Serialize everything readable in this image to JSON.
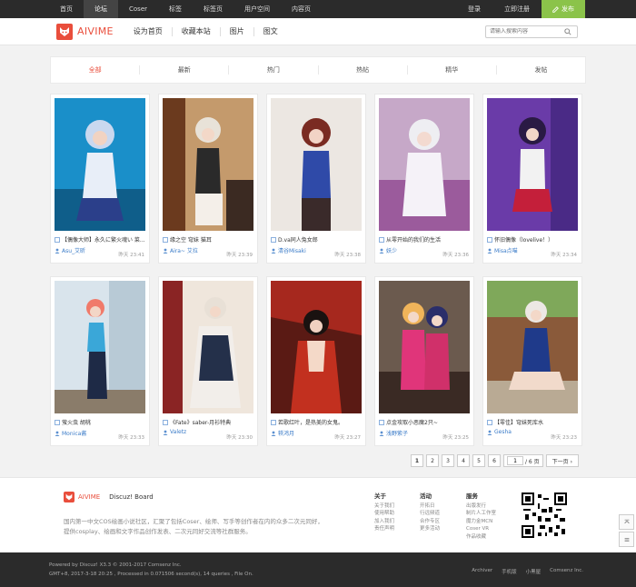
{
  "topnav": [
    "首页",
    "论坛",
    "Coser",
    "标签",
    "标签页",
    "用户空间",
    "内容页"
  ],
  "topright": {
    "login": "登录",
    "register": "立即注册",
    "publish": "发布"
  },
  "logo": {
    "text": "AIVIME"
  },
  "mainnav": [
    "设为首页",
    "收藏本站",
    "图片",
    "图文"
  ],
  "search": {
    "placeholder": "请输入搜索内容"
  },
  "tabs": [
    "全部",
    "最新",
    "热门",
    "热帖",
    "精华",
    "发帖"
  ],
  "cards": [
    {
      "title": "【偶像大师】永久に繁火魂い  菜...",
      "author": "Asu_艾昕",
      "time": "昨天 23:41"
    },
    {
      "title": "缘之空 穹妹 猫耳",
      "author": "Aira~ 艾拉",
      "time": "昨天 23:39"
    },
    {
      "title": "D.va同人兔女郎",
      "author": "清谷Misaki",
      "time": "昨天 23:38"
    },
    {
      "title": "从零开始的我们的生活",
      "author": "妖少",
      "time": "昨天 23:36"
    },
    {
      "title": "怀旧偶像（lovelive！）",
      "author": "Misa点喵",
      "time": "昨天 23:34"
    },
    {
      "title": "萤火虫 胡桃",
      "author": "Monica酱",
      "time": "昨天 23:33"
    },
    {
      "title": "《Fate》saber-月衫特典",
      "author": "Valetz",
      "time": "昨天 23:30"
    },
    {
      "title": "若歌红叶，是热美的女鬼。",
      "author": "轶鸿月",
      "time": "昨天 23:27"
    },
    {
      "title": "点金攻取小恶魔2只~",
      "author": "浅野紫子",
      "time": "昨天 23:25"
    },
    {
      "title": "【零佳】穹妹死库水",
      "author": "Gesha",
      "time": "昨天 23:23"
    }
  ],
  "pager": {
    "pages": [
      "1",
      "2",
      "3",
      "4",
      "5",
      "6"
    ],
    "current": "1",
    "input": "1",
    "total": "/ 6 页",
    "next": "下一页 ›"
  },
  "footer": {
    "logo": "AIVIME",
    "board": "Discuz! Board",
    "desc": "国内第一中文COS绘画小说社区，汇聚了包括Coser、绘师、写手等创作者在内的众多二次元同好，提供cosplay、绘画和文字作品创作发表、二次元同好交流等社群服务。",
    "cols": [
      {
        "title": "关于",
        "items": [
          "关于我们",
          "使用帮助",
          "加入我们",
          "责任声明"
        ]
      },
      {
        "title": "活动",
        "items": [
          "开拓日",
          "行远频道",
          "合作专区",
          "更多活动"
        ]
      },
      {
        "title": "服务",
        "items": [
          "出版发行",
          "制片人工作室",
          "魔力金MCN",
          "Coser VR",
          "作品收藏"
        ]
      }
    ]
  },
  "bottom": {
    "line1": "Powered by Discuz! X3.3 © 2001-2017 Comsenz Inc.",
    "line2": "GMT+8, 2017-3-18 20:25 , Processed in 0.071506 second(s), 14 queries , File On.",
    "links": [
      "Archiver",
      "手机版",
      "小黑屋",
      "Comsenz Inc."
    ]
  },
  "colors": {
    "brand": "#e94e3c",
    "publish": "#8bc34a",
    "topbar": "#2b2b2b",
    "link": "#3a7bc8"
  }
}
